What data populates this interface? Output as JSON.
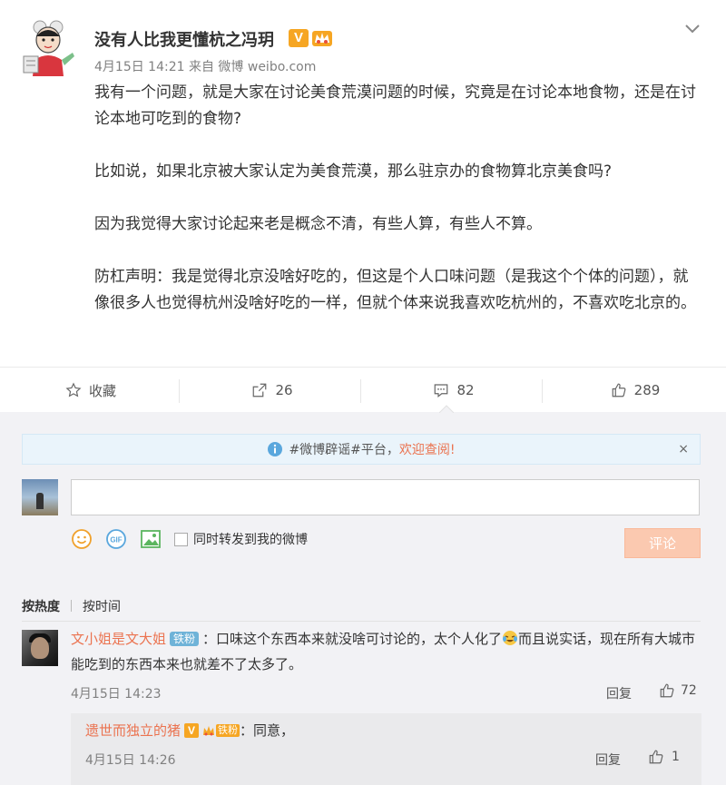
{
  "post": {
    "author": "没有人比我更懂杭之冯玥",
    "verified_badge": "V",
    "meta": "4月15日 14:21 来自 微博 weibo.com",
    "paragraphs": [
      "我有一个问题，就是大家在讨论美食荒漠问题的时候，究竟是在讨论本地食物，还是在讨论本地可吃到的食物?",
      "比如说，如果北京被大家认定为美食荒漠，那么驻京办的食物算北京美食吗?",
      "因为我觉得大家讨论起来老是概念不清，有些人算，有些人不算。",
      "防杠声明：我是觉得北京没啥好吃的，但这是个人口味问题（是我这个个体的问题），就像很多人也觉得杭州没啥好吃的一样，但就个体来说我喜欢吃杭州的，不喜欢吃北京的。"
    ]
  },
  "actions": {
    "favorite": "收藏",
    "repost": "26",
    "comments": "82",
    "likes": "289"
  },
  "notice": {
    "tag": "#微博辟谣#平台，",
    "link": "欢迎查阅!",
    "close": "×"
  },
  "composer": {
    "input_value": "",
    "also_repost_label": "同时转发到我的微博",
    "submit_label": "评论"
  },
  "sort": {
    "by_hot": "按热度",
    "by_time": "按时间"
  },
  "comment": {
    "user": "文小姐是文大姐",
    "fan_badge": "铁粉",
    "text_part1": "：口味这个东西本来就没啥可讨论的，太个人化了",
    "text_part2": "而且说实话，现在所有大城市能吃到的东西本来也就差不了太多了。",
    "time": "4月15日 14:23",
    "reply_label": "回复",
    "likes": "72"
  },
  "reply": {
    "user": "遗世而独立的猪",
    "verified_badge": "V",
    "fan_badge": "铁粉",
    "text": "：同意，",
    "time": "4月15日 14:26",
    "reply_label": "回复",
    "likes": "1"
  },
  "colors": {
    "link_orange": "#eb7350",
    "badge_gold": "#f6a623",
    "fan_blue": "#6fb3d8",
    "submit_disabled": "#fbc9b0"
  }
}
